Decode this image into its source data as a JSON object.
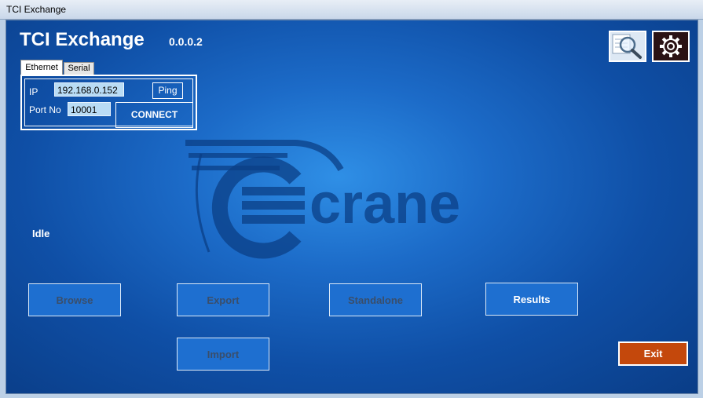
{
  "window": {
    "title": "TCI Exchange"
  },
  "app": {
    "name": "TCI Exchange",
    "version": "0.0.0.2"
  },
  "tabs": {
    "ethernet": "Ethernet",
    "serial": "Serial"
  },
  "connection": {
    "ip_label": "IP",
    "ip_value": "192.168.0.152",
    "port_label": "Port No",
    "port_value": "10001",
    "ping_label": "Ping",
    "connect_label": "CONNECT"
  },
  "toolbar": {
    "search_icon": "search-icon",
    "settings_icon": "gear-icon"
  },
  "status": {
    "text": "Idle"
  },
  "logo": {
    "text": "crane"
  },
  "actions": {
    "browse": "Browse",
    "export": "Export",
    "standalone": "Standalone",
    "results": "Results",
    "import": "Import",
    "exit": "Exit"
  },
  "colors": {
    "exit_button": "#c4480c",
    "background": "#1c6bc8",
    "field_bg": "#b9dcf5"
  }
}
